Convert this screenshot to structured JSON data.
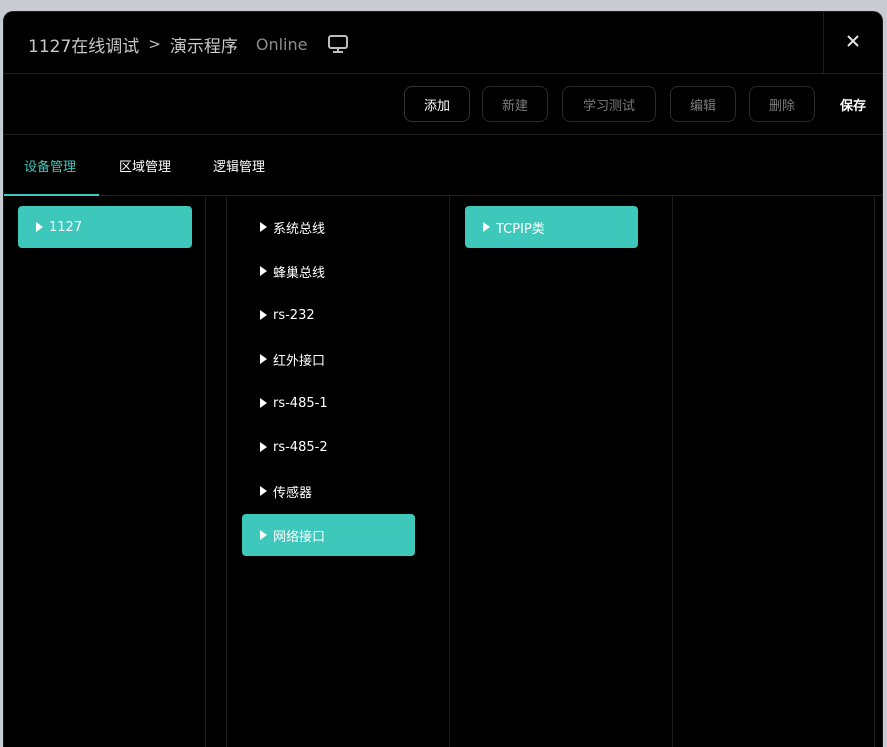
{
  "header": {
    "breadcrumb": [
      "1127在线调试",
      "演示程序"
    ],
    "separator": ">",
    "status": "Online",
    "icons": {
      "monitor": "monitor-icon",
      "close": "close-icon"
    }
  },
  "toolbar": {
    "add_label": "添加",
    "new_label": "新建",
    "learn_test_label": "学习测试",
    "edit_label": "编辑",
    "delete_label": "删除",
    "save_label": "保存"
  },
  "tabs": [
    {
      "label": "设备管理",
      "active": true
    },
    {
      "label": "区域管理",
      "active": false
    },
    {
      "label": "逻辑管理",
      "active": false
    }
  ],
  "columns": {
    "devices": [
      {
        "label": "1127",
        "selected": true
      }
    ],
    "interfaces": [
      {
        "label": "系统总线",
        "selected": false
      },
      {
        "label": "蜂巢总线",
        "selected": false
      },
      {
        "label": "rs-232",
        "selected": false
      },
      {
        "label": "红外接口",
        "selected": false
      },
      {
        "label": "rs-485-1",
        "selected": false
      },
      {
        "label": "rs-485-2",
        "selected": false
      },
      {
        "label": "传感器",
        "selected": false
      },
      {
        "label": "网络接口",
        "selected": true
      }
    ],
    "categories": [
      {
        "label": "TCPIP类",
        "selected": true
      }
    ]
  },
  "colors": {
    "accent": "#3ec8bb",
    "background": "#000000",
    "divider": "#1f1f1f",
    "disabled_text": "#7a7a7a"
  }
}
